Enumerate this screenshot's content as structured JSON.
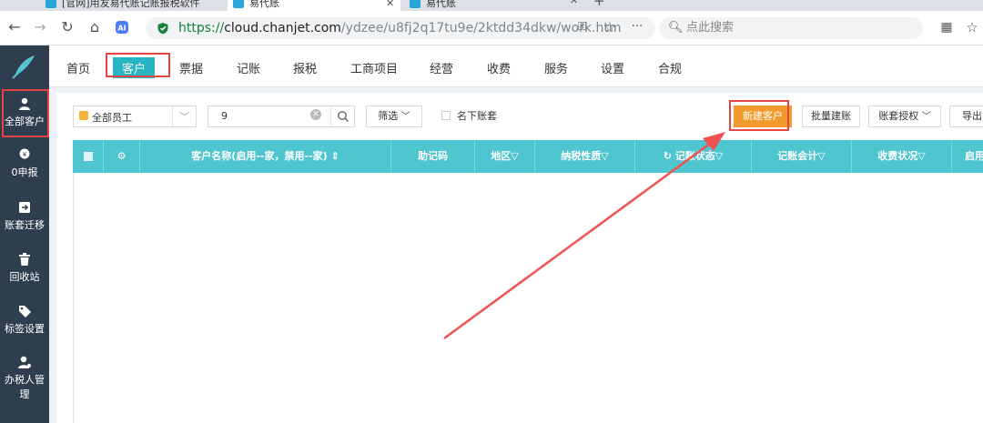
{
  "browser": {
    "tabs": [
      {
        "title": "[官网]用友易代账记账报税软件"
      },
      {
        "title": "易代账"
      },
      {
        "title": "易代账"
      }
    ],
    "url_scheme": "https://",
    "url_domain": "cloud.chanjet.com",
    "url_path": "/ydzee/u8fj2q17tu9e/2ktdd34dkw/work.htm",
    "search_placeholder": "点此搜索"
  },
  "topnav": {
    "items": [
      "首页",
      "客户",
      "票据",
      "记账",
      "报税",
      "工商项目",
      "经营",
      "收费",
      "服务",
      "设置",
      "合规"
    ],
    "active": "客户"
  },
  "sidebar": {
    "items": [
      "全部客户",
      "0申报",
      "账套迁移",
      "回收站",
      "标签设置",
      "办税人管理"
    ]
  },
  "toolbar": {
    "staff_select": "全部员工",
    "search_value": "9",
    "filter_label": "筛选",
    "under_name_label": "名下账套",
    "new_customer": "新建客户",
    "batch_create": "批量建账",
    "auth_label": "账套授权",
    "export_label": "导出"
  },
  "table": {
    "headers": [
      "客户名称(启用--家，禁用--家)",
      "助记码",
      "地区",
      "纳税性质",
      "记账状态",
      "记账会计",
      "收费状况",
      "启用"
    ]
  },
  "colors": {
    "sidebar": "#2f3e4e",
    "accent": "#28b5c3",
    "table_header": "#4fc6cf",
    "primary_button": "#f39a2e",
    "highlight": "#e64343"
  }
}
